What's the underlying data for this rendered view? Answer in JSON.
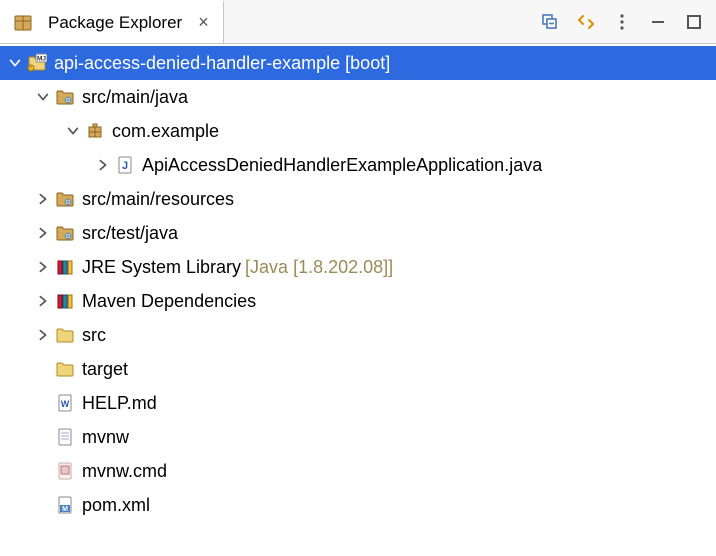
{
  "view": {
    "title": "Package Explorer"
  },
  "tree": {
    "project": {
      "label": "api-access-denied-handler-example",
      "suffix": "[boot]"
    },
    "src_main_java": "src/main/java",
    "pkg": "com.example",
    "java_file": "ApiAccessDeniedHandlerExampleApplication.java",
    "src_main_resources": "src/main/resources",
    "src_test_java": "src/test/java",
    "jre": {
      "label": "JRE System Library",
      "suffix": "[Java [1.8.202.08]]"
    },
    "maven": "Maven Dependencies",
    "src_folder": "src",
    "target_folder": "target",
    "help_md": "HELP.md",
    "mvnw": "mvnw",
    "mvnw_cmd": "mvnw.cmd",
    "pom": "pom.xml"
  }
}
